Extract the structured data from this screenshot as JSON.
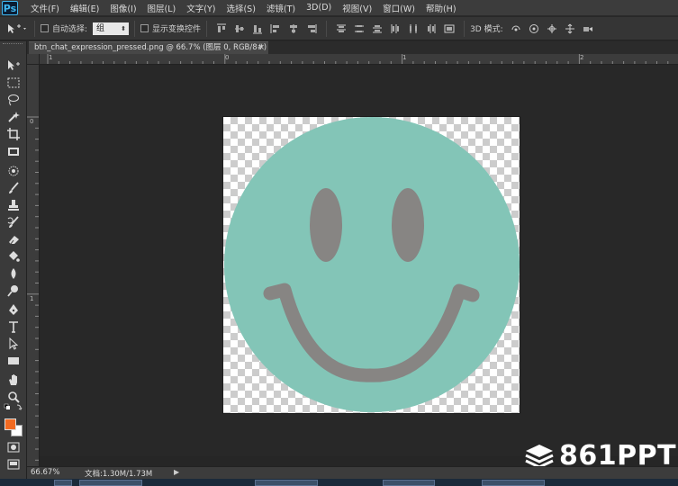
{
  "app": {
    "logo": "Ps"
  },
  "menu": [
    "文件(F)",
    "编辑(E)",
    "图像(I)",
    "图层(L)",
    "文字(Y)",
    "选择(S)",
    "滤镜(T)",
    "3D(D)",
    "视图(V)",
    "窗口(W)",
    "帮助(H)"
  ],
  "options": {
    "auto_select_label": "自动选择:",
    "auto_select_value": "组",
    "show_transform_label": "显示变换控件",
    "mode_3d_label": "3D 模式:"
  },
  "document": {
    "tab_title": "btn_chat_expression_pressed.png @ 66.7% (图层 0, RGB/8#)",
    "close_glyph": "×"
  },
  "rulers": {
    "top_labels": [
      "1",
      "0",
      "1",
      "2"
    ],
    "left_labels": [
      "0",
      "1"
    ]
  },
  "status": {
    "zoom": "66.67%",
    "doc_info": "文档:1.30M/1.73M",
    "arrow": "▶"
  },
  "artwork": {
    "face_color": "#83c5b7",
    "feature_color": "#878583"
  },
  "watermark": {
    "text": "861PPT"
  },
  "colors": {
    "foreground": "#f26a21",
    "background": "#ffffff"
  }
}
